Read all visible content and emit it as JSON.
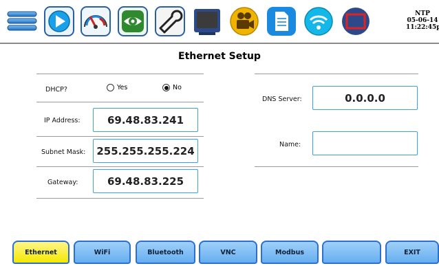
{
  "toolbar": {
    "icons": [
      {
        "name": "menu-icon",
        "color": "#2f84cf"
      },
      {
        "name": "play-icon",
        "color": "#1aa0e8"
      },
      {
        "name": "gauge-icon",
        "color": "#cc2222"
      },
      {
        "name": "eye-icon",
        "color": "#2f8a2f"
      },
      {
        "name": "wrench-icon",
        "color": "#222222"
      },
      {
        "name": "display-icon",
        "color": "#2c4a8a"
      },
      {
        "name": "video-camera-icon",
        "color": "#f0b400"
      },
      {
        "name": "document-icon",
        "color": "#1a8ae0"
      },
      {
        "name": "wifi-icon",
        "color": "#14b8e8"
      },
      {
        "name": "window-icon",
        "color": "#cc2222"
      }
    ],
    "clock": {
      "source": "NTP",
      "date": "05-06-14",
      "time": "11:22:45pm"
    }
  },
  "page": {
    "title": "Ethernet Setup"
  },
  "form": {
    "dhcp": {
      "label": "DHCP?",
      "yes_label": "Yes",
      "no_label": "No",
      "selected": "No"
    },
    "ip": {
      "label": "IP Address:",
      "value": "69.48.83.241"
    },
    "subnet": {
      "label": "Subnet Mask:",
      "value": "255.255.255.224"
    },
    "gateway": {
      "label": "Gateway:",
      "value": "69.48.83.225"
    },
    "dns": {
      "label": "DNS Server:",
      "value": "0.0.0.0"
    },
    "name": {
      "label": "Name:",
      "value": ""
    }
  },
  "tabs": [
    {
      "label": "Ethernet",
      "active": true
    },
    {
      "label": "WiFi",
      "active": false
    },
    {
      "label": "Bluetooth",
      "active": false
    },
    {
      "label": "VNC",
      "active": false
    },
    {
      "label": "Modbus",
      "active": false
    },
    {
      "label": "",
      "active": false
    },
    {
      "label": "EXIT",
      "active": false
    }
  ],
  "colors": {
    "field_border": "#3aa0e8",
    "tab_fill": "#8cc6f6",
    "tab_active": "#f5e800",
    "tab_border": "#2b6fd0"
  }
}
